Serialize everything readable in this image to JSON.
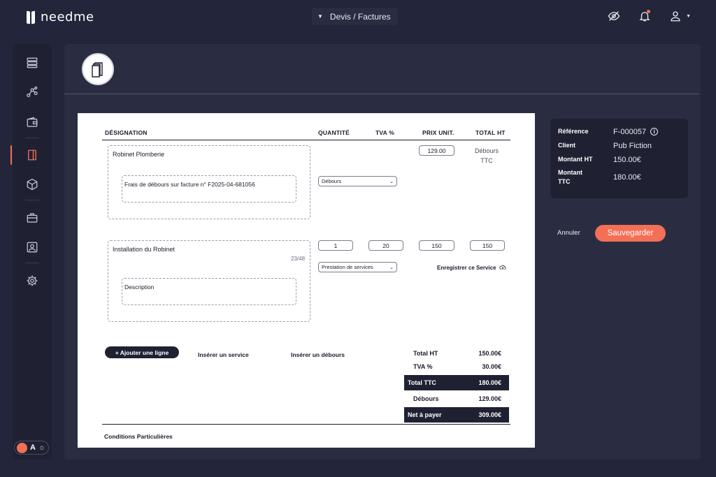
{
  "app": {
    "name": "needme"
  },
  "header": {
    "module_label": "Devis / Factures"
  },
  "sidebar": {
    "items": [
      {
        "icon": "server-icon"
      },
      {
        "icon": "network-icon"
      },
      {
        "icon": "wallet-icon"
      },
      {
        "icon": "book-icon",
        "active": true
      },
      {
        "icon": "box-icon"
      },
      {
        "icon": "briefcase-icon"
      },
      {
        "icon": "team-icon"
      },
      {
        "icon": "gear-icon"
      }
    ],
    "theme_toggle_label": "A"
  },
  "invoice": {
    "columns": {
      "designation": "DÉSIGNATION",
      "quantity": "QUANTITÉ",
      "vat": "TVA %",
      "unit_price": "PRIX UNIT.",
      "total": "TOTAL HT"
    },
    "lines": [
      {
        "title": "Robinet Plomberie",
        "description": "Frais de débours sur facture n° F2025-04-681056",
        "type": "Débours",
        "unit_price": "129.00",
        "total_line1": "Débours",
        "total_line2": "TTC"
      },
      {
        "title": "Installation du Robinet",
        "char_count": "23/48",
        "description_placeholder": "Description",
        "type": "Prestation de services",
        "quantity": "1",
        "vat": "20",
        "unit_price": "150",
        "total": "150",
        "save_service_label": "Enregistrer ce Service"
      }
    ],
    "actions": {
      "add_line": "+ Ajouter une ligne",
      "insert_service": "Insérer un service",
      "insert_debours": "Insérer un débours"
    },
    "totals": [
      {
        "label": "Total HT",
        "value": "150.00€",
        "highlight": false
      },
      {
        "label": "TVA %",
        "value": "30.00€",
        "highlight": false
      },
      {
        "label": "Total TTC",
        "value": "180.00€",
        "highlight": true
      },
      {
        "label": "Débours",
        "value": "129.00€",
        "highlight": false
      },
      {
        "label": "Net à payer",
        "value": "309.00€",
        "highlight": true
      }
    ],
    "conditions_label": "Conditions Particulières"
  },
  "summary": {
    "reference_label": "Référence",
    "reference_value": "F-000057",
    "client_label": "Client",
    "client_value": "Pub Fiction",
    "ht_label": "Montant HT",
    "ht_value": "150.00€",
    "ttc_label_1": "Montant",
    "ttc_label_2": "TTC",
    "ttc_value": "180.00€"
  },
  "buttons": {
    "cancel": "Annuler",
    "save": "Sauvegarder"
  },
  "colors": {
    "accent": "#f36f56",
    "background": "#23263a",
    "panel": "#2a2d42",
    "dark": "#1f2133"
  }
}
